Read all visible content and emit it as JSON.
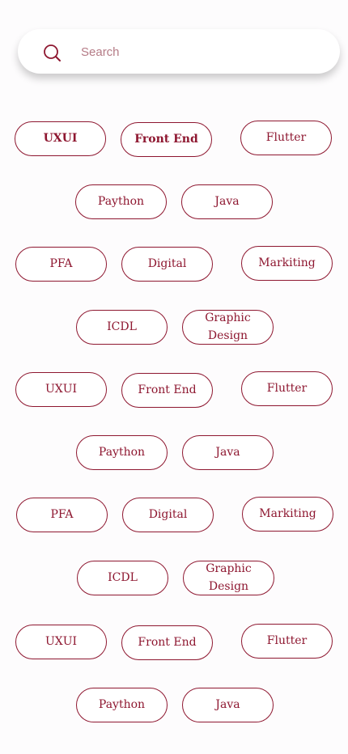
{
  "search": {
    "placeholder": "Search",
    "icon": "search-icon"
  },
  "colors": {
    "accent": "#8e1730",
    "background": "#fdfcfd",
    "chip_fill": "#ffffff"
  },
  "chips": [
    {
      "label": "UXUI"
    },
    {
      "label": "Front End"
    },
    {
      "label": "Flutter"
    },
    {
      "label": "Paython"
    },
    {
      "label": "Java"
    },
    {
      "label": "PFA"
    },
    {
      "label": "Digital"
    },
    {
      "label": "Markiting"
    },
    {
      "label": "ICDL"
    },
    {
      "label": "Graphic Design"
    },
    {
      "label": "UXUI"
    },
    {
      "label": "Front End"
    },
    {
      "label": "Flutter"
    },
    {
      "label": "Paython"
    },
    {
      "label": "Java"
    },
    {
      "label": "PFA"
    },
    {
      "label": "Digital"
    },
    {
      "label": "Markiting"
    },
    {
      "label": "ICDL"
    },
    {
      "label": "Graphic Design"
    },
    {
      "label": "UXUI"
    },
    {
      "label": "Front End"
    },
    {
      "label": "Flutter"
    },
    {
      "label": "Paython"
    },
    {
      "label": "Java"
    }
  ]
}
